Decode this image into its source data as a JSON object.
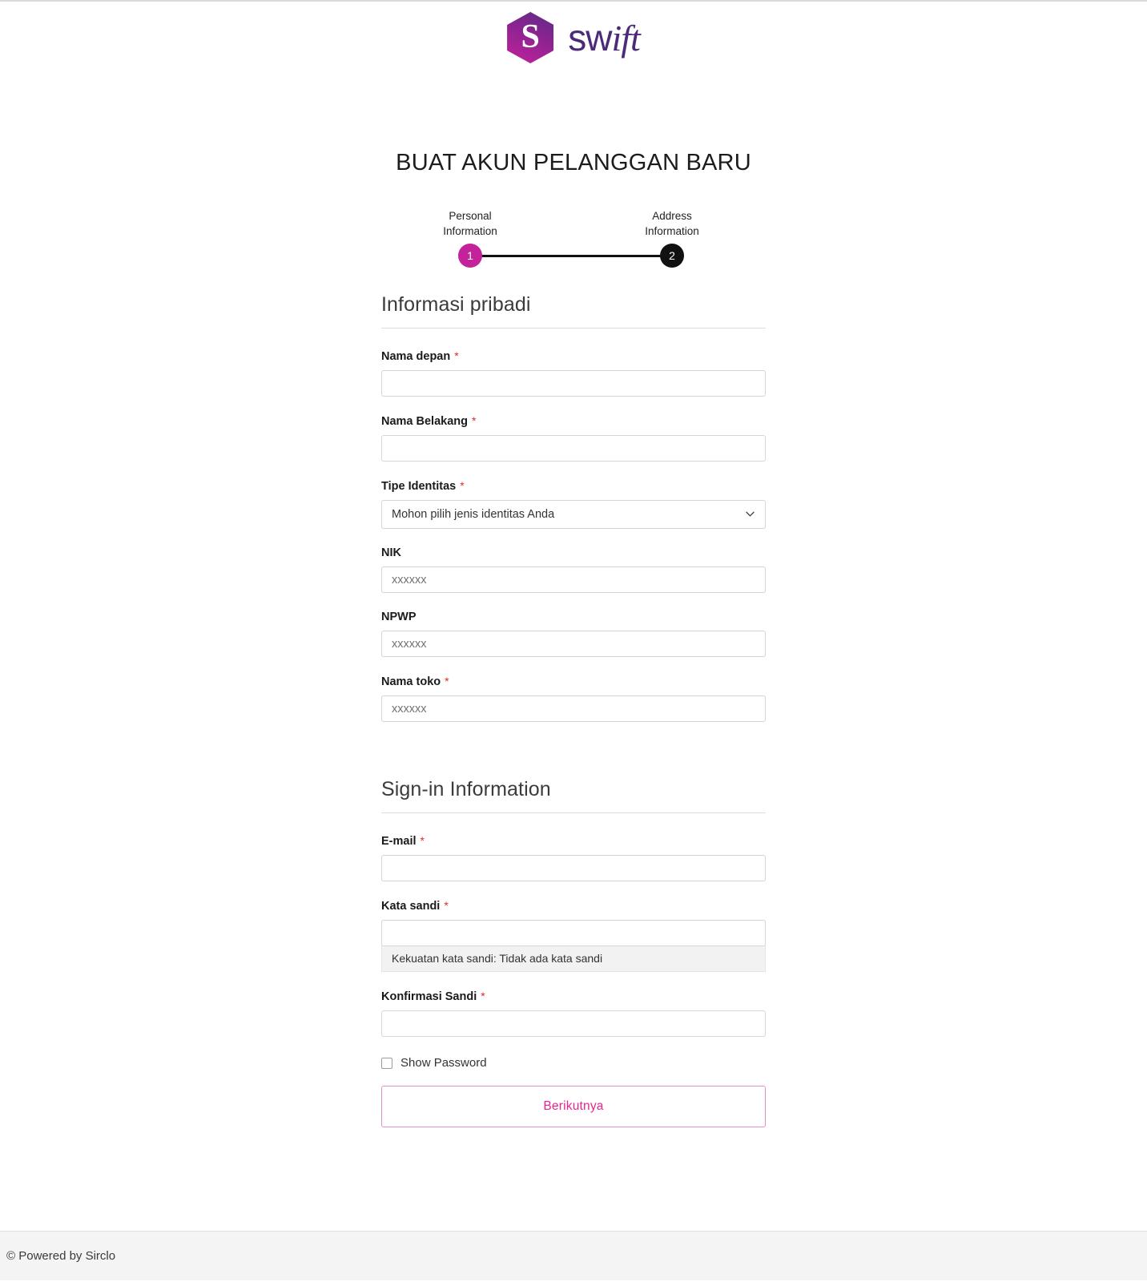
{
  "brand": {
    "logo_letter": "S",
    "name_part1": "sw",
    "name_part2": "ift"
  },
  "page_title": "BUAT AKUN PELANGGAN BARU",
  "stepper": {
    "steps": [
      {
        "label": "Personal\nInformation",
        "number": "1",
        "state": "active"
      },
      {
        "label": "Address\nInformation",
        "number": "2",
        "state": "inactive"
      }
    ]
  },
  "sections": [
    {
      "heading": "Informasi pribadi",
      "fields": [
        {
          "label": "Nama depan",
          "required": true,
          "placeholder": "",
          "value": "",
          "type": "text"
        },
        {
          "label": "Nama Belakang",
          "required": true,
          "placeholder": "",
          "value": "",
          "type": "text"
        },
        {
          "label": "Tipe Identitas",
          "required": true,
          "selected": "Mohon pilih jenis identitas Anda",
          "type": "select"
        },
        {
          "label": "NIK",
          "required": false,
          "placeholder": "xxxxxx",
          "value": "",
          "type": "text"
        },
        {
          "label": "NPWP",
          "required": false,
          "placeholder": "xxxxxx",
          "value": "",
          "type": "text"
        },
        {
          "label": "Nama toko",
          "required": true,
          "placeholder": "xxxxxx",
          "value": "",
          "type": "text"
        }
      ]
    },
    {
      "heading": "Sign-in Information",
      "fields": [
        {
          "label": "E-mail",
          "required": true,
          "placeholder": "",
          "value": "",
          "type": "text"
        },
        {
          "label": "Kata sandi",
          "required": true,
          "placeholder": "",
          "value": "",
          "type": "password"
        },
        {
          "label": "Konfirmasi Sandi",
          "required": true,
          "placeholder": "",
          "value": "",
          "type": "password"
        }
      ]
    }
  ],
  "password_strength": "Kekuatan kata sandi: Tidak ada kata sandi",
  "show_password": {
    "label": "Show Password",
    "checked": false
  },
  "submit_button": "Berikutnya",
  "footer": {
    "text": "© Powered by Sirclo"
  },
  "colors": {
    "accent_magenta": "#c4229b",
    "button_text": "#e6268f",
    "button_border": "#e58fcb",
    "required_red": "#e02b27",
    "step_inactive": "#111111",
    "logo_purple": "#4b2a7b"
  }
}
